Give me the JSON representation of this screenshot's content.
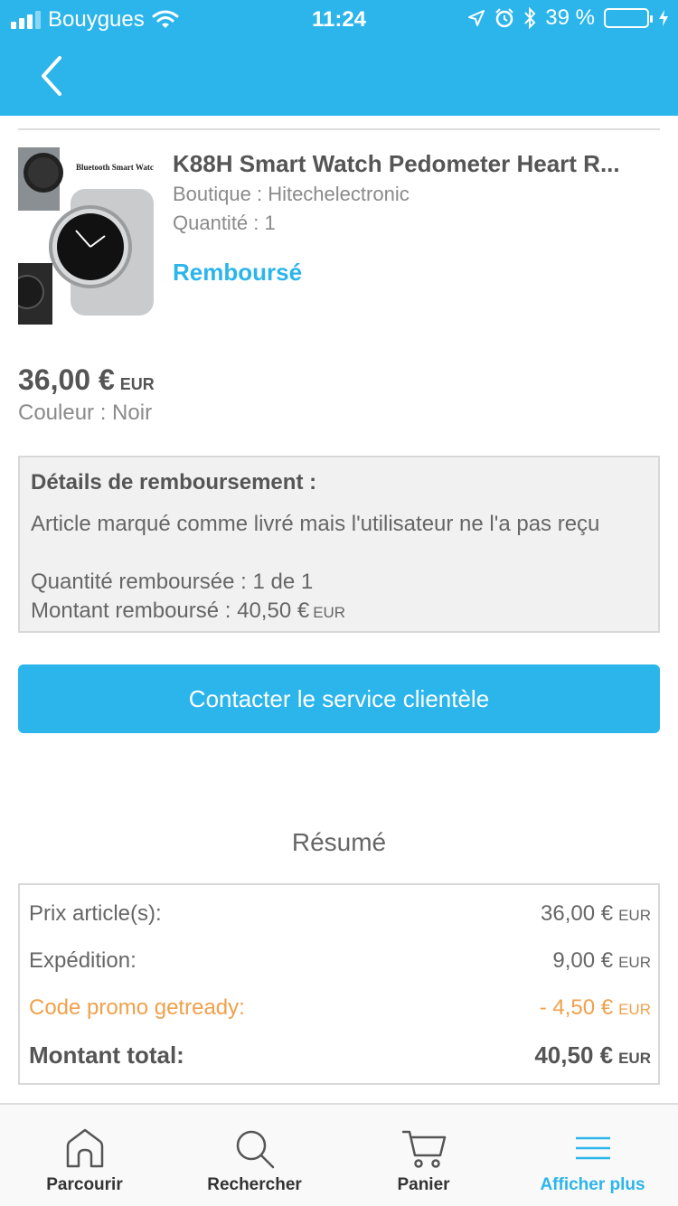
{
  "status_bar": {
    "carrier": "Bouygues",
    "time": "11:24",
    "battery_text": "39 %",
    "battery_level": 0.39
  },
  "nav": {
    "back_icon": "chevron-left-icon"
  },
  "product": {
    "image_text": "Bluetooth Smart Watc",
    "title": "K88H Smart Watch Pedometer Heart R...",
    "shop": "Boutique : Hitechelectronic",
    "quantity": "Quantité : 1",
    "status": "Remboursé",
    "price": "36,00 €",
    "price_currency": "EUR",
    "color": "Couleur : Noir"
  },
  "refund": {
    "heading": "Détails de remboursement :",
    "reason": "Article marqué comme livré mais l'utilisateur ne l'a pas reçu",
    "quantity": "Quantité remboursée : 1 de 1",
    "amount": "Montant remboursé : 40,50 €",
    "amount_currency": "EUR"
  },
  "contact_button": "Contacter le service clientèle",
  "summary": {
    "title": "Résumé",
    "rows": [
      {
        "label": "Prix article(s):",
        "value": "36,00 €",
        "currency": "EUR"
      },
      {
        "label": "Expédition:",
        "value": "9,00 €",
        "currency": "EUR"
      },
      {
        "label": "Code promo getready:",
        "value": "- 4,50 €",
        "currency": "EUR"
      },
      {
        "label": "Montant total:",
        "value": "40,50 €",
        "currency": "EUR"
      }
    ]
  },
  "tabbar": {
    "items": [
      {
        "label": "Parcourir",
        "icon": "home-icon"
      },
      {
        "label": "Rechercher",
        "icon": "search-icon"
      },
      {
        "label": "Panier",
        "icon": "cart-icon"
      },
      {
        "label": "Afficher plus",
        "icon": "menu-icon"
      }
    ],
    "active_index": 3
  },
  "colors": {
    "accent": "#2cb5eb",
    "promo": "#f0a04b",
    "battery": "#4cd964"
  }
}
